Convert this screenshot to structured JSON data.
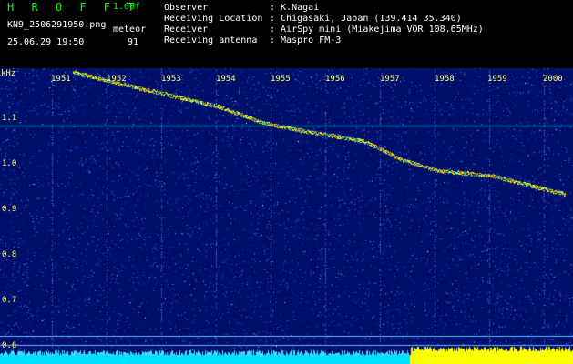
{
  "header": {
    "logo": "H R O F F T",
    "version": "1.00f",
    "filename": "KN9_2506291950.png",
    "datetime": "25.06.29 19:50",
    "meteor_label": "meteor",
    "meteor_count": "91",
    "info": [
      {
        "label": "Observer",
        "value": ": K.Nagai"
      },
      {
        "label": "Receiving Location",
        "value": ": Chigasaki, Japan (139.414 35.340)"
      },
      {
        "label": "Receiver",
        "value": ": AirSpy mini (Miakejima VOR 108.65MHz)"
      },
      {
        "label": "Receiving antenna",
        "value": ": Maspro FM-3"
      }
    ]
  },
  "spectrogram": {
    "y_unit": "kHz",
    "y_ticks": [
      "1.1",
      "1.0",
      "0.9",
      "0.8",
      "0.7",
      "0.6"
    ],
    "x_ticks": [
      "1951",
      "1952",
      "1953",
      "1954",
      "1955",
      "1956",
      "1957",
      "1958",
      "1959",
      "2000"
    ],
    "colors": {
      "background": "#00106a",
      "noise": "#2a5cff",
      "signal": "#ffff00",
      "accent": "#00ffff"
    }
  }
}
